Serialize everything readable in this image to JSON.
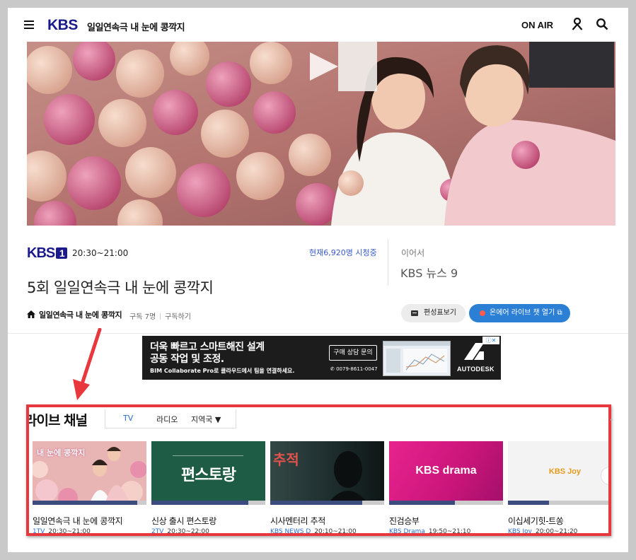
{
  "header": {
    "logo": "KBS",
    "program_title": "일일연속극 내 눈에 콩깍지",
    "onair_label": "ON AIR",
    "icons": [
      "hamburger-menu-icon",
      "user-icon",
      "search-icon"
    ]
  },
  "hero": {
    "play_icon": "play-icon"
  },
  "broadcast": {
    "channel_logo": "KBS",
    "channel_number": "1",
    "time": "20:30~21:00",
    "viewers": "현재6,920명 시청중",
    "next_label": "이어서",
    "next_program": "KBS 뉴스 9",
    "episode_title": "5회 일일연속극 내 눈에 콩깍지",
    "home_link": "일일연속극 내 눈에 콩깍지",
    "subscribers": "구독 7명",
    "subscribe_label": "구독하기",
    "schedule_button": "편성표보기",
    "chat_button": "온에어 라이브 챗 열기 ⧉"
  },
  "ad": {
    "headline_1": "더욱 빠르고 스마트해진 설계",
    "headline_2": "공동 작업 및 조정.",
    "subline": "BIM Collaborate Pro로 클라우드에서 팀을 연결하세요.",
    "cta": "구매 상담 문의",
    "phone": "✆ 0079-8611-0047",
    "brand": "AUTODESK",
    "adchoices": "ⓘ✕"
  },
  "live": {
    "title": "라이브 채널",
    "tabs": [
      "TV",
      "라디오",
      "지역국 ▼"
    ],
    "active_tab": "TV",
    "cards": [
      {
        "title": "일일연속극 내 눈에 콩깍지",
        "channel": "1TV",
        "time": "20:30~21:00",
        "progress": 0.92,
        "thumb_text": "내 눈에 콩깍지"
      },
      {
        "title": "신상 출시 편스토랑",
        "channel": "2TV",
        "time": "20:30~22:00",
        "progress": 0.85,
        "thumb_text": "편스토랑"
      },
      {
        "title": "시사멘터리 추적",
        "channel": "KBS NEWS D",
        "time": "20:10~21:00",
        "progress": 0.81,
        "thumb_text": "추적"
      },
      {
        "title": "진검승부",
        "channel": "KBS Drama",
        "time": "19:50~21:10",
        "progress": 0.58,
        "thumb_text": "KBS drama"
      },
      {
        "title": "이십세기힛-트쏭",
        "channel": "KBS Joy",
        "time": "20:00~21:20",
        "progress": 0.36,
        "thumb_text": "KBS Joy"
      }
    ]
  },
  "colors": {
    "accent_blue": "#2b7fd4",
    "kbs_navy": "#1a1a8c",
    "highlight_red": "#e8383d"
  }
}
